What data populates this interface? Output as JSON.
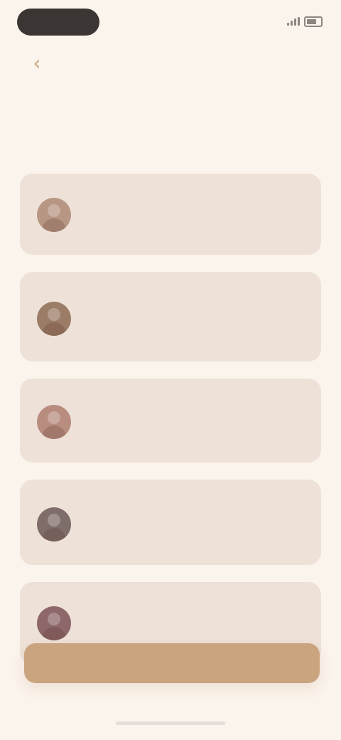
{
  "status": {
    "time": "",
    "network": "",
    "battery": ""
  },
  "header": {
    "back_icon": "back-arrow-icon",
    "title": "",
    "subtitle": ""
  },
  "contacts": [
    {
      "name": "",
      "meta": "",
      "avatar_color": "#b79684"
    },
    {
      "name": "",
      "meta": "",
      "avatar_color": "#9b7d67"
    },
    {
      "name": "",
      "meta": "",
      "avatar_color": "#b98c80"
    },
    {
      "name": "",
      "meta": "",
      "avatar_color": "#7f6d6a"
    },
    {
      "name": "",
      "meta": "",
      "avatar_color": "#8d6769"
    }
  ],
  "primary_action": {
    "label": ""
  },
  "colors": {
    "background": "#fbf4ec",
    "card": "#eee1d7",
    "accent": "#caa37f"
  }
}
